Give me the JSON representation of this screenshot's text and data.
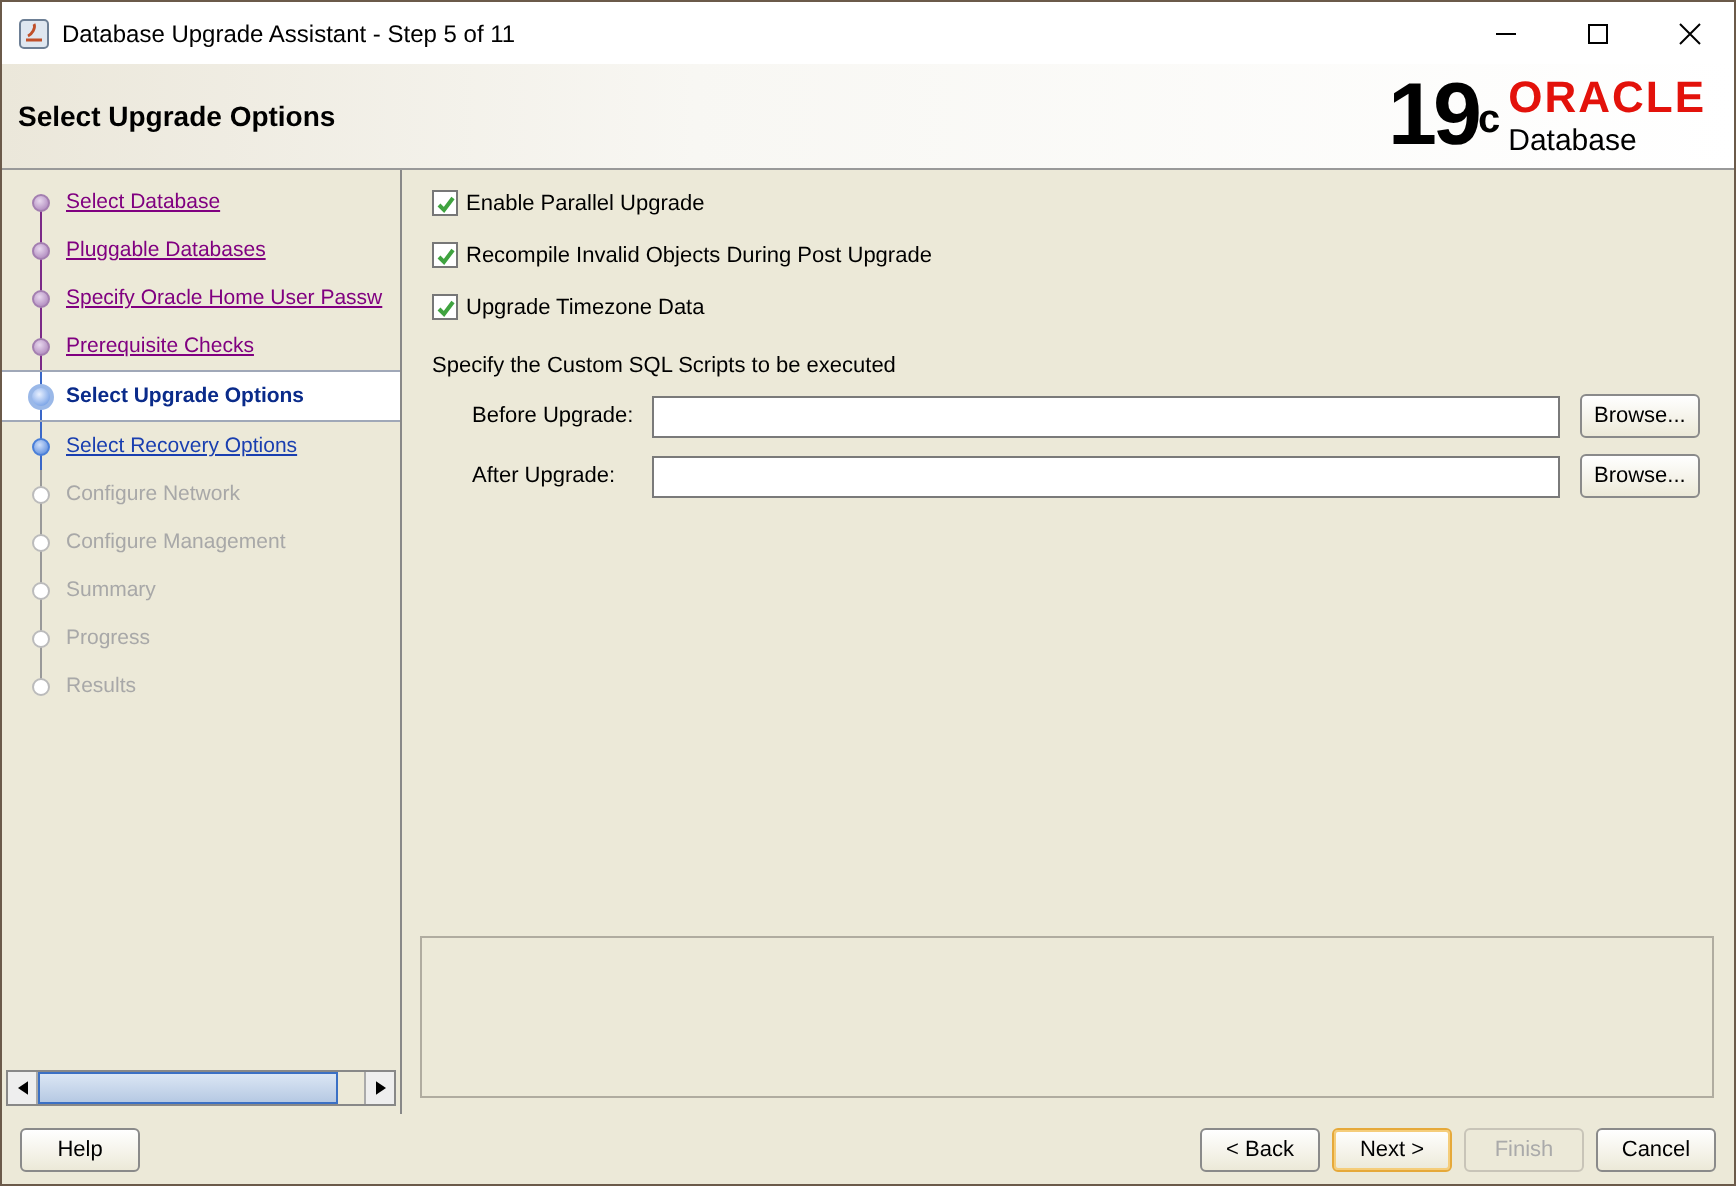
{
  "window": {
    "title": "Database Upgrade Assistant - Step 5 of 11"
  },
  "header": {
    "title": "Select Upgrade Options",
    "logo": {
      "version": "19",
      "suffix": "c",
      "brand": "ORACLE",
      "product": "Database"
    }
  },
  "steps": [
    {
      "label": "Select Database",
      "kind": "done",
      "selected": false
    },
    {
      "label": "Pluggable Databases",
      "kind": "done",
      "selected": false
    },
    {
      "label": "Specify Oracle Home User Passw",
      "kind": "done",
      "selected": false
    },
    {
      "label": "Prerequisite Checks",
      "kind": "done",
      "selected": false
    },
    {
      "label": "Select Upgrade Options",
      "kind": "current",
      "selected": true
    },
    {
      "label": "Select Recovery Options",
      "kind": "next",
      "selected": false
    },
    {
      "label": "Configure Network",
      "kind": "pending",
      "selected": false
    },
    {
      "label": "Configure Management",
      "kind": "pending",
      "selected": false
    },
    {
      "label": "Summary",
      "kind": "pending",
      "selected": false
    },
    {
      "label": "Progress",
      "kind": "pending",
      "selected": false
    },
    {
      "label": "Results",
      "kind": "pending",
      "selected": false
    }
  ],
  "options": [
    {
      "label": "Enable Parallel Upgrade",
      "checked": true
    },
    {
      "label": "Recompile Invalid Objects During Post Upgrade",
      "checked": true
    },
    {
      "label": "Upgrade Timezone Data",
      "checked": true
    }
  ],
  "scripts": {
    "heading": "Specify the Custom SQL Scripts to be executed",
    "fields": [
      {
        "label": "Before Upgrade:",
        "button": "Browse..."
      },
      {
        "label": "After Upgrade:",
        "button": "Browse..."
      }
    ]
  },
  "buttons": {
    "help": "Help",
    "back": "< Back",
    "next": "Next >",
    "finish": "Finish",
    "finish_disabled": true,
    "cancel": "Cancel"
  }
}
